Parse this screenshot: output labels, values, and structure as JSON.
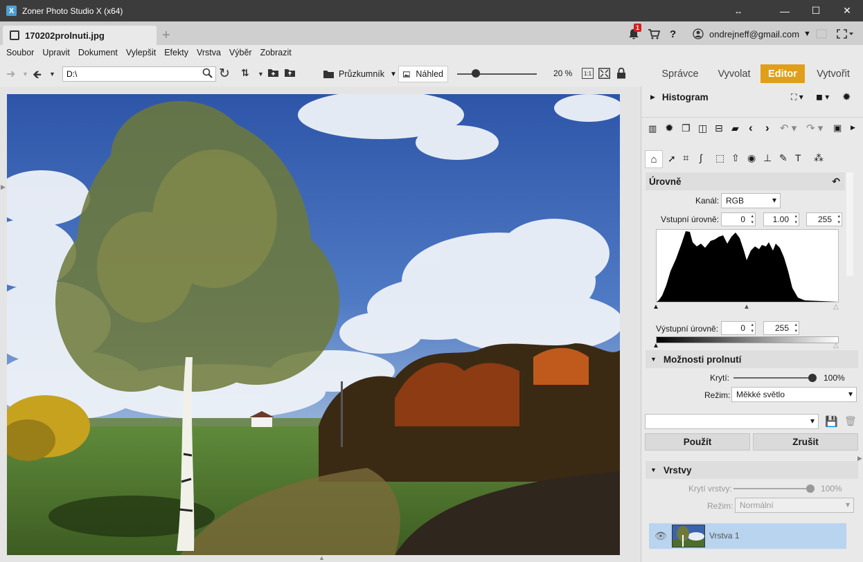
{
  "window": {
    "title": "Zoner Photo Studio X (x64)",
    "icon": "X"
  },
  "window_controls": {
    "restore": "↔",
    "minimize": "—",
    "maximize": "☐",
    "close": "✕"
  },
  "document_tab": {
    "label": "170202prolnuti.jpg",
    "add": "+"
  },
  "account": {
    "notifications_count": "1",
    "help": "?",
    "email": "ondrejneff@gmail.com"
  },
  "menu": [
    "Soubor",
    "Upravit",
    "Dokument",
    "Vylepšit",
    "Efekty",
    "Vrstva",
    "Výběr",
    "Zobrazit"
  ],
  "toolbar": {
    "path": "D:\\",
    "browser_label": "Průzkumník",
    "preview_label": "Náhled",
    "zoom_percent": "20 %",
    "zoom_level": 0.2,
    "one_to_one": "1:1"
  },
  "modes": [
    "Správce",
    "Vyvolat",
    "Editor",
    "Vytvořit"
  ],
  "active_mode": "Editor",
  "panel": {
    "histogram_title": "Histogram",
    "levels_title": "Úrovně",
    "channel_label": "Kanál:",
    "channel_value": "RGB",
    "input_levels_label": "Vstupní úrovně:",
    "input_black": "0",
    "input_gamma": "1.00",
    "input_white": "255",
    "output_levels_label": "Výstupní úrovně:",
    "output_black": "0",
    "output_white": "255",
    "blend_title": "Možnosti prolnutí",
    "opacity_label": "Krytí:",
    "opacity_value": "100%",
    "mode_label": "Režim:",
    "mode_value": "Měkké světlo",
    "preset_value": "",
    "apply_label": "Použít",
    "cancel_label": "Zrušit",
    "layers_title": "Vrstvy",
    "layer_opacity_label": "Krytí vrstvy:",
    "layer_opacity_value": "100%",
    "layer_mode_label": "Režim:",
    "layer_mode_value": "Normální",
    "layer_name": "Vrstva 1"
  },
  "colors": {
    "accent": "#e09f1a",
    "titlebar": "#3c3c3c",
    "layer_selected": "#b9d4ef"
  }
}
